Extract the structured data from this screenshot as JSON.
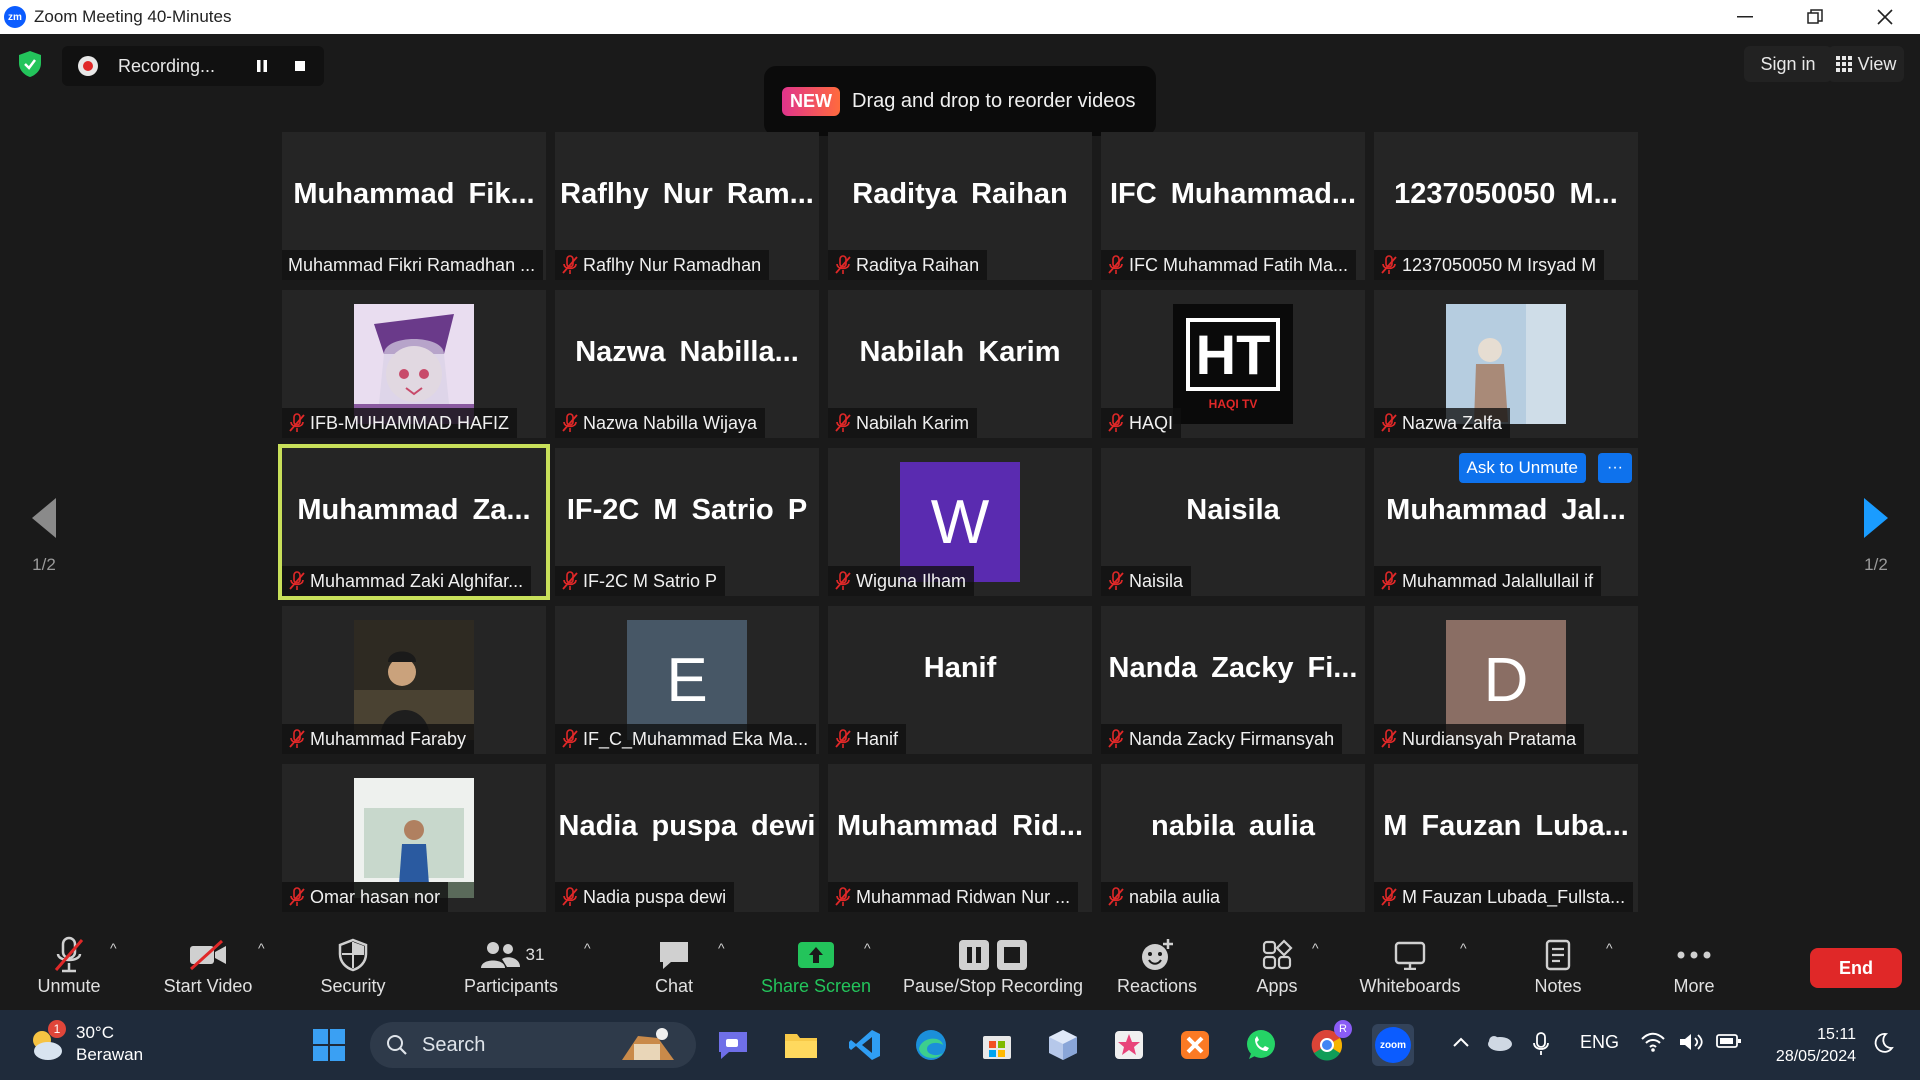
{
  "window": {
    "title": "Zoom Meeting 40-Minutes",
    "logo_text": "zm"
  },
  "top": {
    "recording_label": "Recording...",
    "banner_badge": "NEW",
    "banner_text": "Drag and drop to reorder videos",
    "sign_in": "Sign in",
    "view": "View"
  },
  "pager": {
    "left": "1/2",
    "right": "1/2"
  },
  "tiles": [
    {
      "big": "Muhammad  Fik...",
      "name": "Muhammad Fikri Ramadhan ...",
      "muted": false
    },
    {
      "big": "Raflhy  Nur  Ram...",
      "name": "Raflhy Nur Ramadhan",
      "muted": true
    },
    {
      "big": "Raditya  Raihan",
      "name": "Raditya Raihan",
      "muted": true
    },
    {
      "big": "IFC  Muhammad...",
      "name": "IFC Muhammad Fatih Ma...",
      "muted": true
    },
    {
      "big": "1237050050  M...",
      "name": "1237050050 M Irsyad M",
      "muted": true
    },
    {
      "big": "",
      "name": "IFB-MUHAMMAD HAFIZ",
      "muted": true
    },
    {
      "big": "Nazwa  Nabilla...",
      "name": "Nazwa Nabilla Wijaya",
      "muted": true
    },
    {
      "big": "Nabilah  Karim",
      "name": "Nabilah Karim",
      "muted": true
    },
    {
      "big": "",
      "name": "HAQI",
      "muted": true
    },
    {
      "big": "",
      "name": "Nazwa Zalfa",
      "muted": true
    },
    {
      "big": "Muhammad  Za...",
      "name": "Muhammad Zaki Alghifar...",
      "muted": true
    },
    {
      "big": "IF-2C  M  Satrio  P",
      "name": "IF-2C M Satrio P",
      "muted": true
    },
    {
      "big": "",
      "name": "Wiguna Ilham",
      "muted": true
    },
    {
      "big": "Naisila",
      "name": "Naisila",
      "muted": true
    },
    {
      "big": "Muhammad  Jal...",
      "name": "Muhammad Jalallullail if",
      "muted": true
    },
    {
      "big": "",
      "name": "Muhammad Faraby",
      "muted": true
    },
    {
      "big": "",
      "name": "IF_C_Muhammad Eka Ma...",
      "muted": true
    },
    {
      "big": "Hanif",
      "name": "Hanif",
      "muted": true
    },
    {
      "big": "Nanda  Zacky  Fi...",
      "name": "Nanda Zacky Firmansyah",
      "muted": true
    },
    {
      "big": "",
      "name": "Nurdiansyah Pratama",
      "muted": true
    },
    {
      "big": "",
      "name": "Omar hasan nor",
      "muted": true
    },
    {
      "big": "Nadia  puspa  dewi",
      "name": "Nadia puspa dewi",
      "muted": true
    },
    {
      "big": "Muhammad  Rid...",
      "name": "Muhammad Ridwan Nur ...",
      "muted": true
    },
    {
      "big": "nabila  aulia",
      "name": "nabila aulia",
      "muted": true
    },
    {
      "big": "M  Fauzan  Luba...",
      "name": "M Fauzan Lubada_Fullsta...",
      "muted": true
    }
  ],
  "avatars": {
    "haqi_logo": "HT",
    "haqi_sub": "HAQI TV",
    "wiguna_letter": "W",
    "eka_letter": "E",
    "nurdiansyah_letter": "D"
  },
  "tile_actions": {
    "ask_unmute": "Ask to Unmute",
    "more": "···"
  },
  "toolbar": {
    "unmute": "Unmute",
    "start_video": "Start Video",
    "security": "Security",
    "participants": "Participants",
    "participants_count": "31",
    "chat": "Chat",
    "share_screen": "Share Screen",
    "pause_stop": "Pause/Stop Recording",
    "reactions": "Reactions",
    "apps": "Apps",
    "whiteboards": "Whiteboards",
    "notes": "Notes",
    "more": "More",
    "end": "End"
  },
  "taskbar": {
    "temperature": "30°C",
    "weather": "Berawan",
    "weather_badge": "1",
    "search": "Search",
    "chrome_badge": "R",
    "zoom_label": "zoom",
    "lang": "ENG",
    "time": "15:11",
    "date": "28/05/2024"
  },
  "colors": {
    "accent_blue": "#0e72ed",
    "end_red": "#e02828",
    "share_green": "#23c45b",
    "active_outline": "#c8e05a",
    "mic_muted_red": "#e02828"
  }
}
